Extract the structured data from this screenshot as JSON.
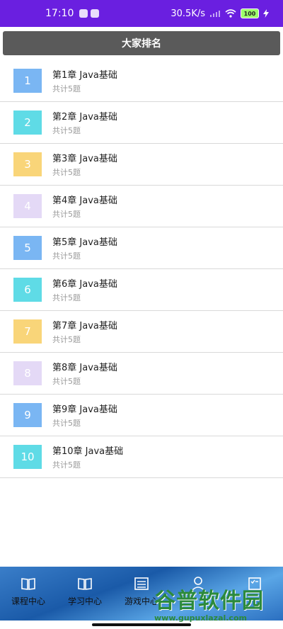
{
  "status_bar": {
    "time": "17:10",
    "network_speed": "30.5K/s",
    "battery": "100"
  },
  "title": "大家排名",
  "chapters": [
    {
      "number": "1",
      "name": "第1章 Java基础",
      "count": "共计5题",
      "color": "#7ab6f3"
    },
    {
      "number": "2",
      "name": "第2章 Java基础",
      "count": "共计5题",
      "color": "#5fdbe6"
    },
    {
      "number": "3",
      "name": "第3章 Java基础",
      "count": "共计5题",
      "color": "#f9d579"
    },
    {
      "number": "4",
      "name": "第4章 Java基础",
      "count": "共计5题",
      "color": "#e4d9f6"
    },
    {
      "number": "5",
      "name": "第5章 Java基础",
      "count": "共计5题",
      "color": "#7ab6f3"
    },
    {
      "number": "6",
      "name": "第6章 Java基础",
      "count": "共计5题",
      "color": "#5fdbe6"
    },
    {
      "number": "7",
      "name": "第7章 Java基础",
      "count": "共计5题",
      "color": "#f9d579"
    },
    {
      "number": "8",
      "name": "第8章 Java基础",
      "count": "共计5题",
      "color": "#e4d9f6"
    },
    {
      "number": "9",
      "name": "第9章 Java基础",
      "count": "共计5题",
      "color": "#7ab6f3"
    },
    {
      "number": "10",
      "name": "第10章 Java基础",
      "count": "共计5题",
      "color": "#5fdbe6"
    }
  ],
  "bottom_nav": [
    {
      "label": "课程中心",
      "icon": "book-icon"
    },
    {
      "label": "学习中心",
      "icon": "book-open-icon"
    },
    {
      "label": "游戏中心",
      "icon": "calculator-icon"
    },
    {
      "label": "",
      "icon": "user-icon"
    },
    {
      "label": "",
      "icon": "checklist-icon"
    }
  ],
  "watermark": {
    "text": "谷普软件园",
    "url": "www.gupuxlazal.com"
  }
}
